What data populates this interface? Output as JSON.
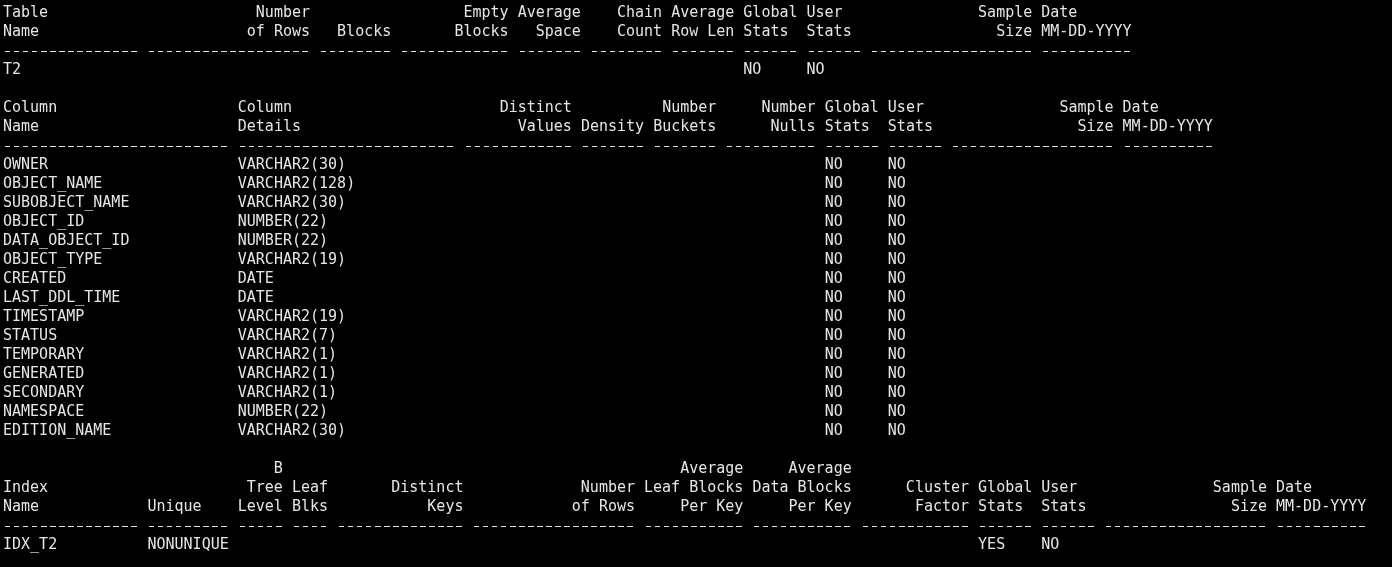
{
  "sections": [
    {
      "kind": "table_stats",
      "header_rows": [
        [
          "Table",
          "Number",
          null,
          "Empty",
          "Average",
          "Chain",
          "Average",
          "Global",
          "User",
          "Sample",
          "Date"
        ],
        [
          "Name",
          "of Rows",
          "Blocks",
          "Blocks",
          "Space",
          "Count",
          "Row Len",
          "Stats",
          "Stats",
          "Size",
          "MM-DD-YYYY"
        ]
      ],
      "rows": [
        [
          "T2",
          null,
          null,
          null,
          null,
          null,
          null,
          "NO",
          "NO",
          null,
          null
        ]
      ]
    },
    {
      "kind": "column_stats",
      "header_rows": [
        [
          "Column",
          "Column",
          "Distinct",
          null,
          "Number",
          "Number",
          "Global",
          "User",
          "Sample",
          "Date"
        ],
        [
          "Name",
          "Details",
          "Values",
          "Density",
          "Buckets",
          "Nulls",
          "Stats",
          "Stats",
          "Size",
          "MM-DD-YYYY"
        ]
      ],
      "rows": [
        [
          "OWNER",
          "VARCHAR2(30)",
          null,
          null,
          null,
          null,
          "NO",
          "NO",
          null,
          null
        ],
        [
          "OBJECT_NAME",
          "VARCHAR2(128)",
          null,
          null,
          null,
          null,
          "NO",
          "NO",
          null,
          null
        ],
        [
          "SUBOBJECT_NAME",
          "VARCHAR2(30)",
          null,
          null,
          null,
          null,
          "NO",
          "NO",
          null,
          null
        ],
        [
          "OBJECT_ID",
          "NUMBER(22)",
          null,
          null,
          null,
          null,
          "NO",
          "NO",
          null,
          null
        ],
        [
          "DATA_OBJECT_ID",
          "NUMBER(22)",
          null,
          null,
          null,
          null,
          "NO",
          "NO",
          null,
          null
        ],
        [
          "OBJECT_TYPE",
          "VARCHAR2(19)",
          null,
          null,
          null,
          null,
          "NO",
          "NO",
          null,
          null
        ],
        [
          "CREATED",
          "DATE",
          null,
          null,
          null,
          null,
          "NO",
          "NO",
          null,
          null
        ],
        [
          "LAST_DDL_TIME",
          "DATE",
          null,
          null,
          null,
          null,
          "NO",
          "NO",
          null,
          null
        ],
        [
          "TIMESTAMP",
          "VARCHAR2(19)",
          null,
          null,
          null,
          null,
          "NO",
          "NO",
          null,
          null
        ],
        [
          "STATUS",
          "VARCHAR2(7)",
          null,
          null,
          null,
          null,
          "NO",
          "NO",
          null,
          null
        ],
        [
          "TEMPORARY",
          "VARCHAR2(1)",
          null,
          null,
          null,
          null,
          "NO",
          "NO",
          null,
          null
        ],
        [
          "GENERATED",
          "VARCHAR2(1)",
          null,
          null,
          null,
          null,
          "NO",
          "NO",
          null,
          null
        ],
        [
          "SECONDARY",
          "VARCHAR2(1)",
          null,
          null,
          null,
          null,
          "NO",
          "NO",
          null,
          null
        ],
        [
          "NAMESPACE",
          "NUMBER(22)",
          null,
          null,
          null,
          null,
          "NO",
          "NO",
          null,
          null
        ],
        [
          "EDITION_NAME",
          "VARCHAR2(30)",
          null,
          null,
          null,
          null,
          "NO",
          "NO",
          null,
          null
        ]
      ]
    },
    {
      "kind": "index_stats",
      "header_rows": [
        [
          null,
          null,
          "B",
          null,
          null,
          null,
          "Average",
          "Average",
          null,
          null,
          null,
          null,
          null
        ],
        [
          "Index",
          null,
          "Tree",
          "Leaf",
          "Distinct",
          "Number",
          "Leaf Blocks",
          "Data Blocks",
          "Cluster",
          "Global",
          "User",
          "Sample",
          "Date"
        ],
        [
          "Name",
          "Unique",
          "Level",
          "Blks",
          "Keys",
          "of Rows",
          "Per Key",
          "Per Key",
          "Factor",
          "Stats",
          "Stats",
          "Size",
          "MM-DD-YYYY"
        ]
      ],
      "rows": [
        [
          "IDX_T2",
          "NONUNIQUE",
          null,
          null,
          null,
          null,
          null,
          null,
          null,
          "YES",
          "NO",
          null,
          null
        ]
      ]
    }
  ]
}
